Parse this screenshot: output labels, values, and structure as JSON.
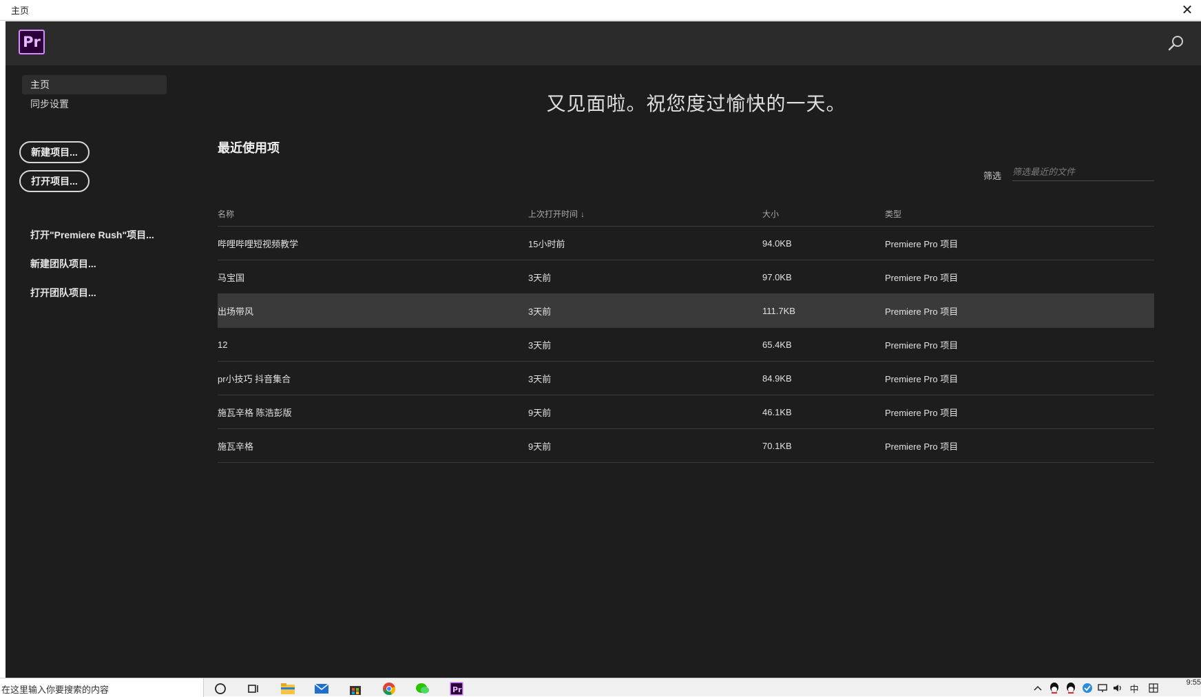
{
  "window": {
    "title": "主页"
  },
  "header": {
    "logo_text": "Pr"
  },
  "sidebar": {
    "nav": [
      "主页",
      "同步设置"
    ],
    "buttons": [
      "新建项目...",
      "打开项目..."
    ],
    "links": [
      "打开\"Premiere Rush\"项目...",
      "新建团队项目...",
      "打开团队项目..."
    ]
  },
  "main": {
    "greeting": "又见面啦。祝您度过愉快的一天。",
    "recent_title": "最近使用项",
    "filter_label": "筛选",
    "filter_placeholder": "筛选最近的文件",
    "columns": [
      "名称",
      "上次打开时间",
      "大小",
      "类型"
    ],
    "sort_indicator": "↓",
    "rows": [
      {
        "name": "哔哩哔哩短视频教学",
        "date": "15小时前",
        "size": "94.0KB",
        "type": "Premiere Pro 项目"
      },
      {
        "name": "马宝国",
        "date": "3天前",
        "size": "97.0KB",
        "type": "Premiere Pro 项目"
      },
      {
        "name": "出场带风",
        "date": "3天前",
        "size": "111.7KB",
        "type": "Premiere Pro 项目",
        "selected": true
      },
      {
        "name": "12",
        "date": "3天前",
        "size": "65.4KB",
        "type": "Premiere Pro 项目"
      },
      {
        "name": "pr小技巧 抖音集合",
        "date": "3天前",
        "size": "84.9KB",
        "type": "Premiere Pro 项目"
      },
      {
        "name": "施瓦辛格 陈浩彭版",
        "date": "9天前",
        "size": "46.1KB",
        "type": "Premiere Pro 项目"
      },
      {
        "name": "施瓦辛格",
        "date": "9天前",
        "size": "70.1KB",
        "type": "Premiere Pro 项目"
      }
    ]
  },
  "taskbar": {
    "search_text": "在这里输入你要搜索的内容",
    "time": "9:55",
    "ime": "中",
    "apps": [
      "search-icon",
      "task-view-icon",
      "file-explorer-icon",
      "mail-icon",
      "store-icon",
      "chrome-icon",
      "wechat-icon",
      "premiere-icon"
    ]
  },
  "colors": {
    "accent": "#d58bff",
    "background": "#1d1d1d",
    "header": "#2b2b2b",
    "selected_row": "#3a3a3a"
  }
}
